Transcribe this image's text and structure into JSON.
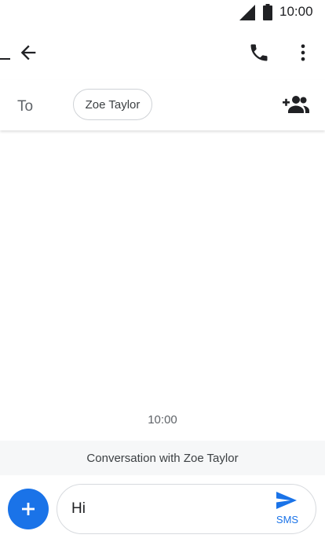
{
  "status_bar": {
    "time": "10:00",
    "icons": [
      "signal-icon",
      "battery-icon"
    ]
  },
  "toolbar": {
    "icons": [
      "back-icon",
      "phone-icon",
      "more-vert-icon"
    ]
  },
  "recipients": {
    "to_label": "To",
    "chip_name": "Zoe Taylor",
    "add_icon": "person-add-icon"
  },
  "conversation": {
    "timestamp": "10:00",
    "banner": "Conversation with Zoe Taylor"
  },
  "compose": {
    "attach_icon": "plus-icon",
    "message": "Hi",
    "send_icon": "send-icon",
    "send_label": "SMS"
  },
  "colors": {
    "accent": "#1a73e8",
    "banner_bg": "#f6f7f8"
  }
}
